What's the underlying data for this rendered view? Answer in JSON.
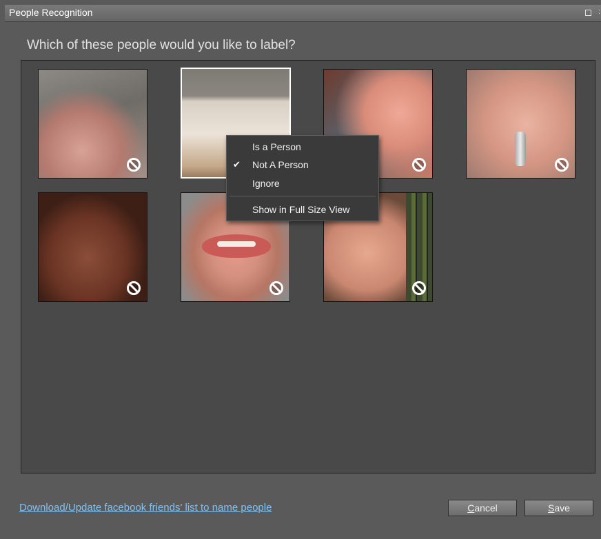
{
  "window": {
    "title": "People Recognition"
  },
  "prompt": "Which of these people would you like to label?",
  "context_menu": {
    "items": [
      {
        "label": "Is a Person",
        "checked": false
      },
      {
        "label": "Not A Person",
        "checked": true
      },
      {
        "label": "Ignore",
        "checked": false
      },
      {
        "label": "Show in Full Size View",
        "checked": false
      }
    ],
    "check_glyph": "✔"
  },
  "footer": {
    "facebook_link": "Download/Update facebook friends' list to name people",
    "cancel_accel": "C",
    "cancel_rest": "ancel",
    "save_accel": "S",
    "save_rest": "ave"
  },
  "colors": {
    "link": "#7fc2f2",
    "panel": "#494949",
    "background": "#5a5a5a"
  },
  "thumbnails": [
    {
      "id": "photo-1",
      "icon": "not-a-person-icon"
    },
    {
      "id": "photo-2",
      "icon": "not-a-person-icon",
      "selected": true
    },
    {
      "id": "photo-3",
      "icon": "not-a-person-icon"
    },
    {
      "id": "photo-4",
      "icon": "not-a-person-icon"
    },
    {
      "id": "photo-5",
      "icon": "not-a-person-icon"
    },
    {
      "id": "photo-6",
      "icon": "not-a-person-icon"
    },
    {
      "id": "photo-7",
      "icon": "not-a-person-icon"
    }
  ]
}
